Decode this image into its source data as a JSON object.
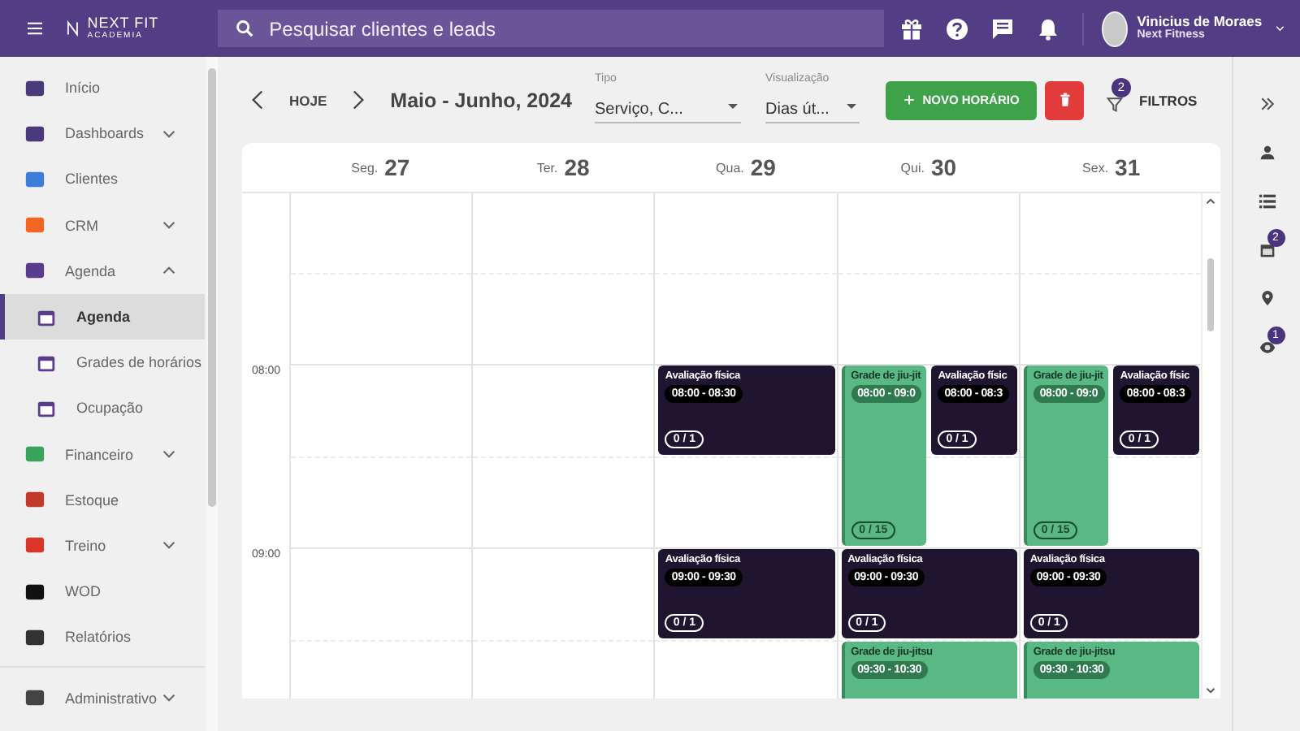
{
  "topbar": {
    "logo": {
      "name": "NEXT FIT",
      "tagline": "ACADEMIA"
    },
    "search": {
      "placeholder": "Pesquisar clientes e leads"
    },
    "user": {
      "name": "Vinicius de Moraes",
      "company": "Next Fitness"
    }
  },
  "sidebar": {
    "items": [
      {
        "label": "Início",
        "color": "#4a3a7a",
        "selected": false
      },
      {
        "label": "Dashboards",
        "color": "#4a3a7a",
        "selected": false,
        "expanded": false
      },
      {
        "label": "Clientes",
        "color": "#3b7dd8",
        "selected": false
      },
      {
        "label": "CRM",
        "color": "#f26522",
        "selected": false,
        "expanded": false
      },
      {
        "label": "Agenda",
        "color": "#5a3d8a",
        "selected": false,
        "expanded": true,
        "children": [
          {
            "label": "Agenda",
            "color": "#5a3d8a",
            "selected": true
          },
          {
            "label": "Grades de horários",
            "color": "#5a3d8a",
            "selected": false
          },
          {
            "label": "Ocupação",
            "color": "#5a3d8a",
            "selected": false
          }
        ]
      },
      {
        "label": "Financeiro",
        "color": "#3aa35b",
        "selected": false,
        "expanded": false
      },
      {
        "label": "Estoque",
        "color": "#c0392b",
        "selected": false
      },
      {
        "label": "Treino",
        "color": "#d9362b",
        "selected": false,
        "expanded": false
      },
      {
        "label": "WOD",
        "color": "#111111",
        "selected": false
      },
      {
        "label": "Relatórios",
        "color": "#333333",
        "selected": false
      },
      {
        "label": "Administrativo",
        "color": "#444444",
        "selected": false,
        "expanded": false
      }
    ]
  },
  "toolbar": {
    "today": "HOJE",
    "range": "Maio - Junho, 2024",
    "type_select": {
      "label": "Tipo",
      "value": "Serviço, C..."
    },
    "view_select": {
      "label": "Visualização",
      "value": "Dias út..."
    },
    "new_button": "NOVO HORÁRIO",
    "filters": {
      "label": "FILTROS",
      "badge": "2"
    }
  },
  "calendar": {
    "hours": [
      {
        "label": "08:00"
      },
      {
        "label": "09:00"
      }
    ],
    "days": [
      {
        "weekday": "Seg.",
        "date": "27"
      },
      {
        "weekday": "Ter.",
        "date": "28"
      },
      {
        "weekday": "Qua.",
        "date": "29",
        "events": [
          {
            "kind": "evaluation",
            "title": "Avaliação física",
            "time": "08:00 - 08:30",
            "count": "0 / 1"
          },
          {
            "kind": "evaluation",
            "title": "Avaliação física",
            "time": "09:00 - 09:30",
            "count": "0 / 1"
          }
        ]
      },
      {
        "weekday": "Qui.",
        "date": "30",
        "events": [
          {
            "kind": "class",
            "title": "Grade de jiu-jit",
            "time": "08:00 - 09:0",
            "count": "0 / 15"
          },
          {
            "kind": "evaluation",
            "title": "Avaliação físic",
            "time": "08:00 - 08:3",
            "count": "0 / 1"
          },
          {
            "kind": "evaluation",
            "title": "Avaliação física",
            "time": "09:00 - 09:30",
            "count": "0 / 1"
          },
          {
            "kind": "class",
            "title": "Grade de jiu-jitsu",
            "time": "09:30 - 10:30"
          }
        ]
      },
      {
        "weekday": "Sex.",
        "date": "31",
        "events": [
          {
            "kind": "class",
            "title": "Grade de jiu-jit",
            "time": "08:00 - 09:0",
            "count": "0 / 15"
          },
          {
            "kind": "evaluation",
            "title": "Avaliação físic",
            "time": "08:00 - 08:3",
            "count": "0 / 1"
          },
          {
            "kind": "evaluation",
            "title": "Avaliação física",
            "time": "09:00 - 09:30",
            "count": "0 / 1"
          },
          {
            "kind": "class",
            "title": "Grade de jiu-jitsu",
            "time": "09:30 - 10:30"
          }
        ]
      }
    ]
  },
  "right_rail": {
    "calendar_badge": "2",
    "eye_badge": "1"
  }
}
